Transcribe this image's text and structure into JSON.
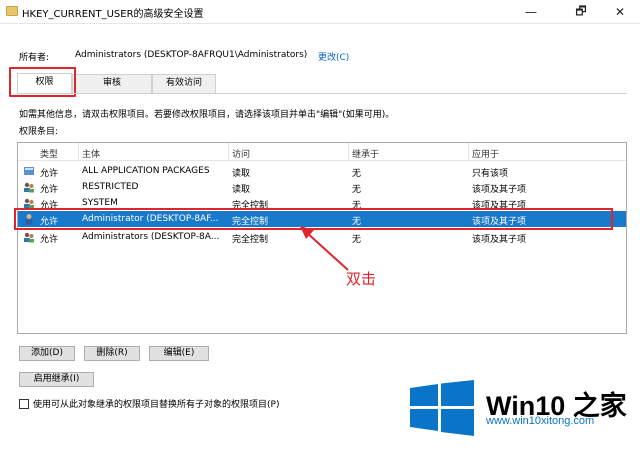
{
  "window": {
    "title": "HKEY_CURRENT_USER的高级安全设置",
    "min": "—",
    "max": "🗗",
    "close": "✕"
  },
  "owner": {
    "label": "所有者:",
    "value": "Administrators (DESKTOP-8AFRQU1\\Administrators)",
    "change_link": "更改(C)"
  },
  "tabs": [
    {
      "label": "权限",
      "active": true
    },
    {
      "label": "审核",
      "active": false
    },
    {
      "label": "有效访问",
      "active": false
    }
  ],
  "info_text": "如需其他信息，请双击权限项目。若要修改权限项目，请选择该项目并单击\"编辑\"(如果可用)。",
  "entries_label": "权限条目:",
  "table": {
    "headers": [
      "类型",
      "主体",
      "访问",
      "继承于",
      "应用于"
    ],
    "rows": [
      {
        "type": "允许",
        "principal": "ALL APPLICATION PACKAGES",
        "access": "读取",
        "inherited": "无",
        "applies": "只有该项",
        "icon": "package-icon"
      },
      {
        "type": "允许",
        "principal": "RESTRICTED",
        "access": "读取",
        "inherited": "无",
        "applies": "该项及其子项",
        "icon": "group-icon"
      },
      {
        "type": "允许",
        "principal": "SYSTEM",
        "access": "完全控制",
        "inherited": "无",
        "applies": "该项及其子项",
        "icon": "group-icon"
      },
      {
        "type": "允许",
        "principal": "Administrator (DESKTOP-8AF...",
        "access": "完全控制",
        "inherited": "无",
        "applies": "该项及其子项",
        "icon": "user-icon",
        "selected": true
      },
      {
        "type": "允许",
        "principal": "Administrators (DESKTOP-8A...",
        "access": "完全控制",
        "inherited": "无",
        "applies": "该项及其子项",
        "icon": "group-icon"
      }
    ]
  },
  "annotation": "双击",
  "buttons": {
    "add": "添加(D)",
    "remove": "删除(R)",
    "edit": "编辑(E)",
    "enable_inheritance": "启用继承(I)"
  },
  "checkbox": {
    "label": "使用可从此对象继承的权限项目替换所有子对象的权限项目(P)",
    "checked": false
  },
  "watermark": {
    "brand": "Win10 之家",
    "url": "www.win10xitong.com"
  },
  "colors": {
    "selection": "#1979ca",
    "highlight": "#e0242b",
    "link": "#0066cc",
    "logo_blue": "#0a74c9"
  }
}
